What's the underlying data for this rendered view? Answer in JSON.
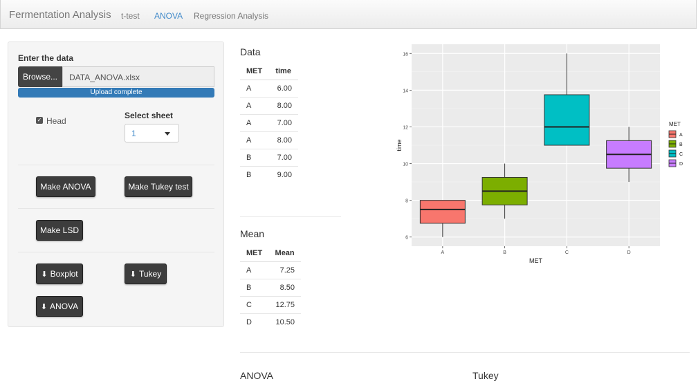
{
  "navbar": {
    "brand": "Fermentation Analysis",
    "tabs": [
      {
        "label": "t-test",
        "active": false
      },
      {
        "label": "ANOVA",
        "active": true
      },
      {
        "label": "Regression Analysis",
        "active": false
      }
    ]
  },
  "sidebar": {
    "enter_label": "Enter the data",
    "browse_label": "Browse...",
    "file_name": "DATA_ANOVA.xlsx",
    "upload_status": "Upload complete",
    "head_checkbox": {
      "label": "Head",
      "checked": true
    },
    "sheet_label": "Select sheet",
    "sheet_value": "1",
    "buttons": {
      "make_anova": "Make ANOVA",
      "make_tukey": "Make Tukey test",
      "make_lsd": "Make LSD",
      "boxplot": "Boxplot",
      "tukey": "Tukey",
      "anova": "ANOVA"
    }
  },
  "data_table": {
    "title": "Data",
    "columns": [
      "MET",
      "time"
    ],
    "rows": [
      [
        "A",
        "6.00"
      ],
      [
        "A",
        "8.00"
      ],
      [
        "A",
        "7.00"
      ],
      [
        "A",
        "8.00"
      ],
      [
        "B",
        "7.00"
      ],
      [
        "B",
        "9.00"
      ]
    ]
  },
  "mean_table": {
    "title": "Mean",
    "columns": [
      "MET",
      "Mean"
    ],
    "rows": [
      [
        "A",
        "7.25"
      ],
      [
        "B",
        "8.50"
      ],
      [
        "C",
        "12.75"
      ],
      [
        "D",
        "10.50"
      ]
    ]
  },
  "bottom": {
    "anova_title": "ANOVA",
    "tukey_title": "Tukey"
  },
  "chart_data": {
    "type": "boxplot",
    "xlabel": "MET",
    "ylabel": "time",
    "ylim": [
      5.5,
      16.5
    ],
    "yticks": [
      6,
      8,
      10,
      12,
      14,
      16
    ],
    "categories": [
      "A",
      "B",
      "C",
      "D"
    ],
    "legend_title": "MET",
    "legend_position": "right",
    "series": [
      {
        "name": "A",
        "color": "#F8766D",
        "min": 6,
        "q1": 6.75,
        "median": 7.5,
        "q3": 8,
        "max": 8
      },
      {
        "name": "B",
        "color": "#7CAE00",
        "min": 7,
        "q1": 7.75,
        "median": 8.5,
        "q3": 9.25,
        "max": 10
      },
      {
        "name": "C",
        "color": "#00BFC4",
        "min": 11,
        "q1": 11,
        "median": 12,
        "q3": 13.75,
        "max": 16
      },
      {
        "name": "D",
        "color": "#C77CFF",
        "min": 9,
        "q1": 9.75,
        "median": 10.5,
        "q3": 11.25,
        "max": 12
      }
    ],
    "panel_background": "#EBEBEB",
    "grid": true
  }
}
